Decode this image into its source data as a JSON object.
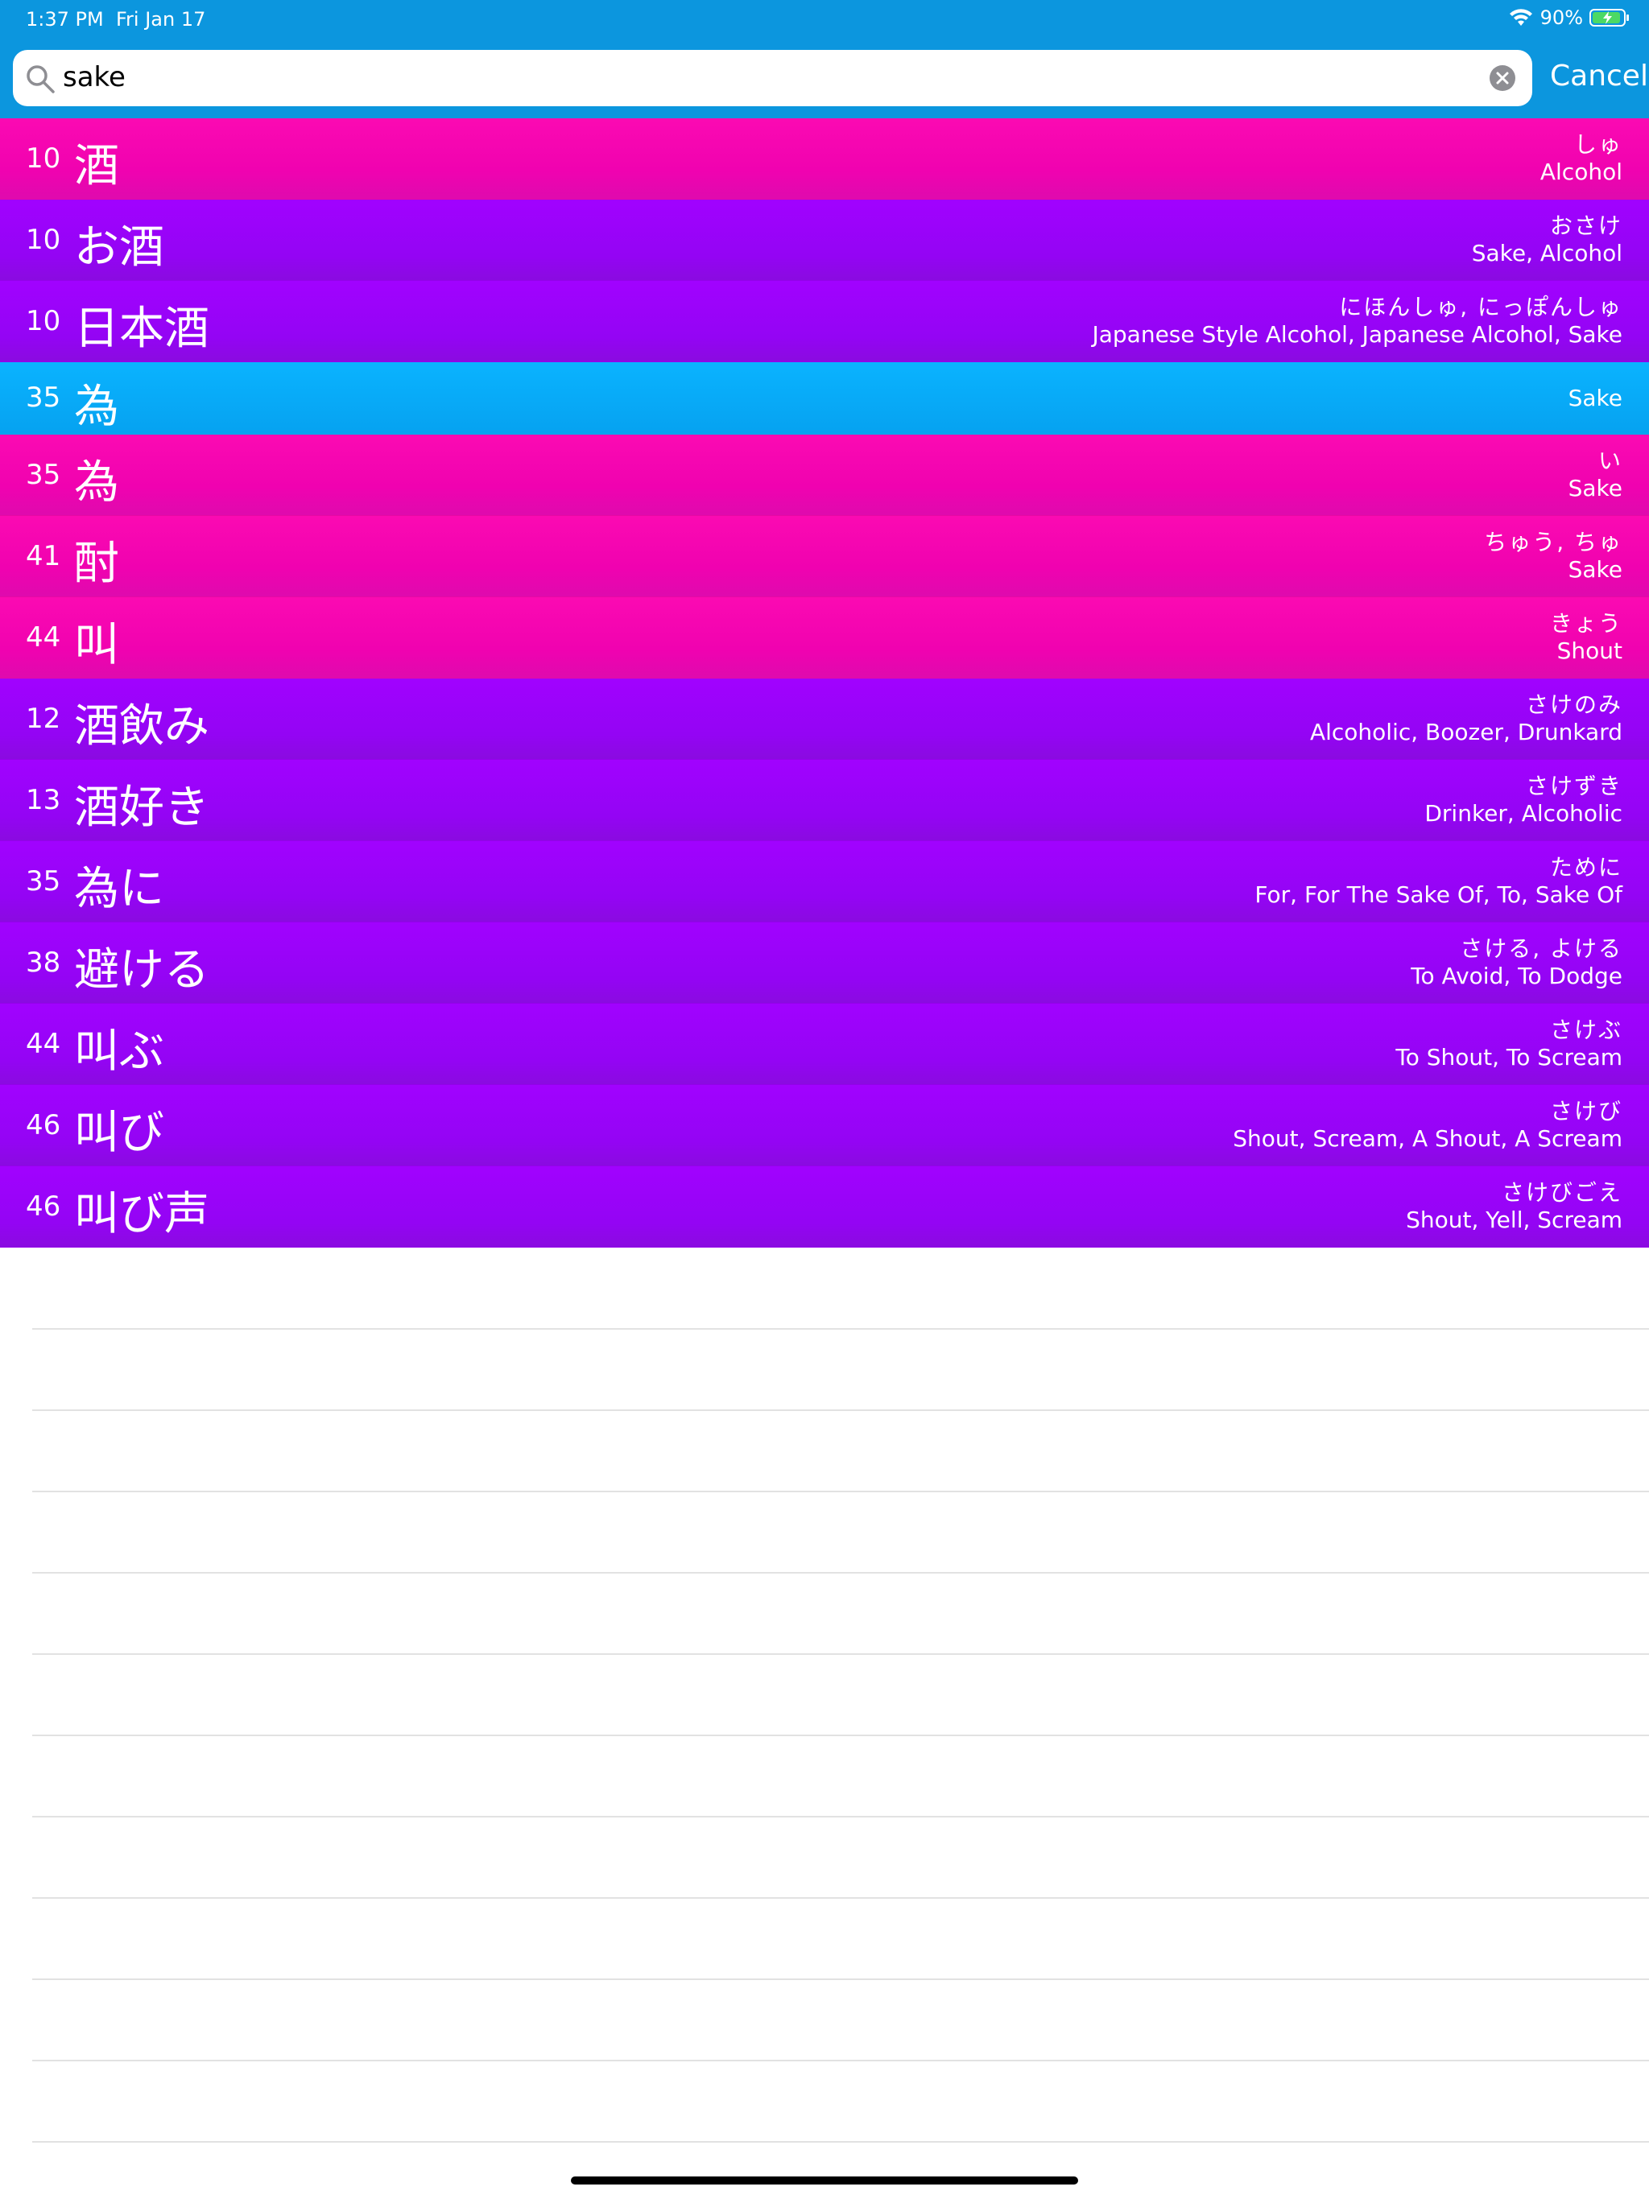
{
  "status_bar": {
    "time": "1:37 PM",
    "date": "Fri Jan 17",
    "battery": "90%"
  },
  "search": {
    "query": "sake",
    "cancel_label": "Cancel"
  },
  "colors": {
    "header": "#0C96DE",
    "pink": "#F002B0",
    "purple": "#9404F4",
    "blue": "#06A2F0"
  },
  "results": [
    {
      "level": "10",
      "word": "酒",
      "reading": "しゅ",
      "meaning": "Alcohol",
      "color": "pink"
    },
    {
      "level": "10",
      "word": "お酒",
      "reading": "おさけ",
      "meaning": "Sake, Alcohol",
      "color": "purple"
    },
    {
      "level": "10",
      "word": "日本酒",
      "reading": "にほんしゅ, にっぽんしゅ",
      "meaning": "Japanese Style Alcohol, Japanese Alcohol, Sake",
      "color": "purple"
    },
    {
      "level": "35",
      "word": "為",
      "reading": "",
      "meaning": "Sake",
      "color": "blue"
    },
    {
      "level": "35",
      "word": "為",
      "reading": "い",
      "meaning": "Sake",
      "color": "pink"
    },
    {
      "level": "41",
      "word": "酎",
      "reading": "ちゅう, ちゅ",
      "meaning": "Sake",
      "color": "pink"
    },
    {
      "level": "44",
      "word": "叫",
      "reading": "きょう",
      "meaning": "Shout",
      "color": "pink"
    },
    {
      "level": "12",
      "word": "酒飲み",
      "reading": "さけのみ",
      "meaning": "Alcoholic, Boozer, Drunkard",
      "color": "purple"
    },
    {
      "level": "13",
      "word": "酒好き",
      "reading": "さけずき",
      "meaning": "Drinker, Alcoholic",
      "color": "purple"
    },
    {
      "level": "35",
      "word": "為に",
      "reading": "ために",
      "meaning": "For, For The Sake Of, To, Sake Of",
      "color": "purple"
    },
    {
      "level": "38",
      "word": "避ける",
      "reading": "さける, よける",
      "meaning": "To Avoid, To Dodge",
      "color": "purple"
    },
    {
      "level": "44",
      "word": "叫ぶ",
      "reading": "さけぶ",
      "meaning": "To Shout, To Scream",
      "color": "purple"
    },
    {
      "level": "46",
      "word": "叫び",
      "reading": "さけび",
      "meaning": "Shout, Scream, A Shout, A Scream",
      "color": "purple"
    },
    {
      "level": "46",
      "word": "叫び声",
      "reading": "さけびごえ",
      "meaning": "Shout, Yell, Scream",
      "color": "purple"
    }
  ]
}
